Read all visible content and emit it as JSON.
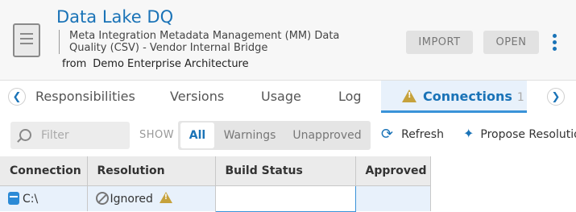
{
  "header": {
    "title": "Data Lake DQ",
    "subtitle": "Meta Integration Metadata Management (MM) Data Quality (CSV) - Vendor Internal Bridge",
    "from_label": "from",
    "from_value": "Demo Enterprise Architecture",
    "import_label": "IMPORT",
    "open_label": "OPEN"
  },
  "tabs": [
    {
      "label": "Responsibilities"
    },
    {
      "label": "Versions"
    },
    {
      "label": "Usage"
    },
    {
      "label": "Log"
    },
    {
      "label": "Connections",
      "count": "1",
      "active": true
    }
  ],
  "toolbar": {
    "filter_placeholder": "Filter",
    "show_label": "SHOW",
    "segments": [
      "All",
      "Warnings",
      "Unapproved"
    ],
    "selected_segment": "All",
    "refresh_label": "Refresh",
    "propose_label": "Propose Resolution"
  },
  "grid": {
    "columns": [
      "Connection",
      "Resolution",
      "Build Status",
      "Approved"
    ],
    "rows": [
      {
        "connection": "C:\\",
        "resolution": "Ignored",
        "build_status": "",
        "approved": ""
      }
    ]
  },
  "colors": {
    "accent": "#1a73b7",
    "warning": "#c6a23c",
    "active_tab_bg": "#e8f1fb"
  }
}
